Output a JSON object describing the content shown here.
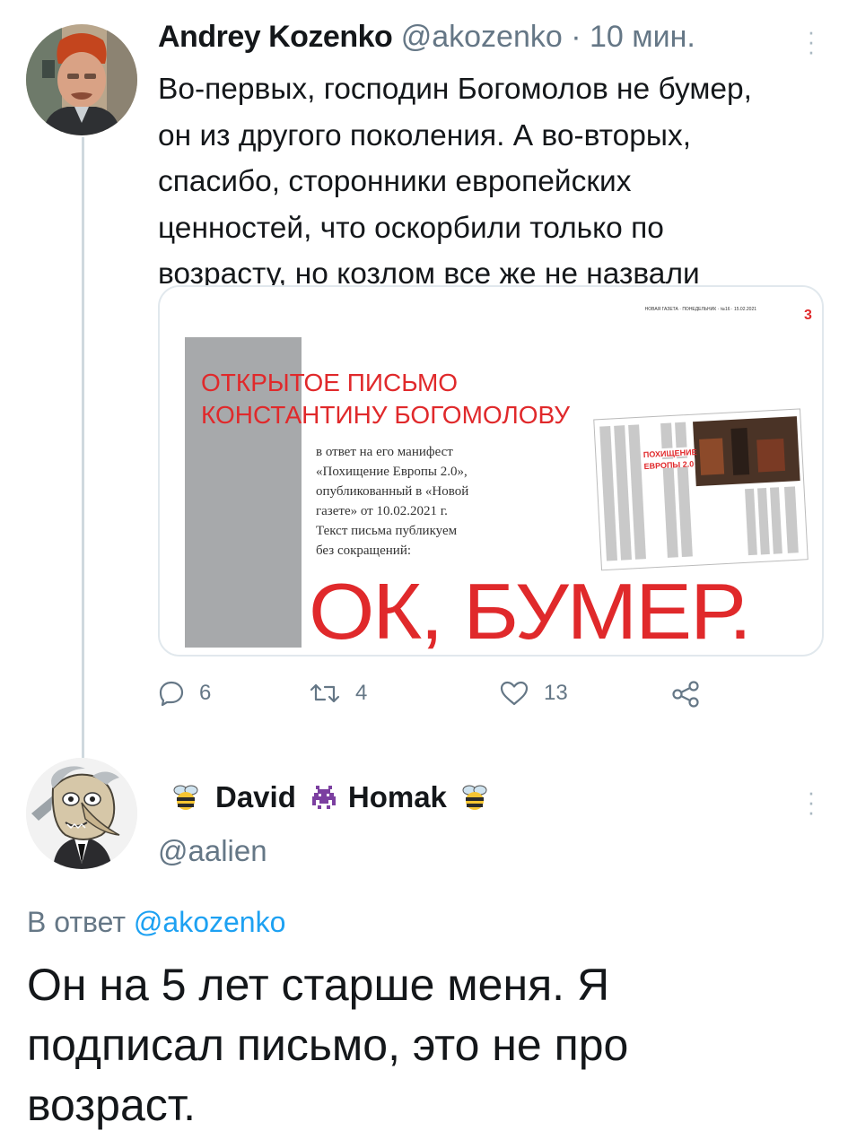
{
  "tweet1": {
    "display_name": "Andrey Kozenko",
    "handle": "@akozenko",
    "dot": "·",
    "time": "10 мин.",
    "text_lines": [
      "Во-первых, господин Богомолов не бумер,",
      "он из другого поколения. А во-вторых,",
      "спасибо, сторонники европейских",
      "ценностей, что оскорбили только по",
      "возрасту, но козлом все же не назвали"
    ],
    "media": {
      "page_number": "3",
      "masthead": "НОВАЯ ГАЗЕТА · ПОНЕДЕЛЬНИК · №16 · 15.02.2021",
      "headline_line1": "ОТКРЫТОЕ ПИСЬМО",
      "headline_line2": "КОНСТАНТИНУ БОГОМОЛОВУ",
      "subtext_lines": [
        "в ответ на его манифест",
        "«Похищение Европы 2.0»,",
        "опубликованный в «Новой",
        "газете» от 10.02.2021 г.",
        "Текст письма публикуем",
        "без сокращений:"
      ],
      "thumb_title_1": "ПОХИЩЕНИЕ",
      "thumb_title_2": "ЕВРОПЫ 2.0",
      "big_text": "ОК, БУМЕР."
    },
    "actions": {
      "replies": "6",
      "retweets": "4",
      "likes": "13"
    }
  },
  "tweet2": {
    "display_name_part1": "David",
    "display_name_part2": "Homak",
    "handle": "@aalien",
    "reply_prefix": "В ответ",
    "reply_mention": "@akozenko",
    "text_lines": [
      "Он на 5 лет старше меня. Я",
      "подписал письмо, это не про",
      "возраст."
    ]
  },
  "colors": {
    "accent": "#1da1f2",
    "muted": "#657786",
    "headline_red": "#e0292b",
    "thread_line": "#cfd9de"
  }
}
